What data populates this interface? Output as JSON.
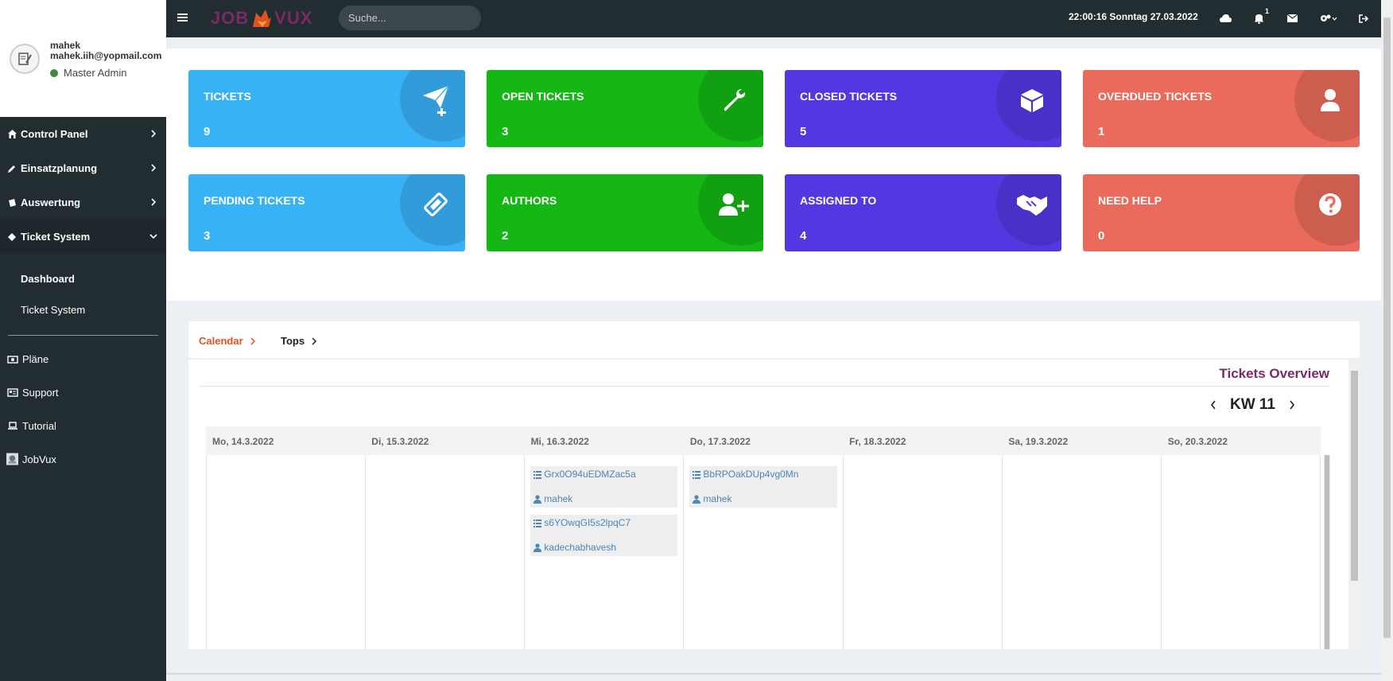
{
  "user": {
    "name": "mahek",
    "email": "mahek.iih@yopmail.com",
    "role": "Master Admin",
    "status_color": "#3d8b3d"
  },
  "sidebar": {
    "items": [
      {
        "label": "Control Panel",
        "icon": "home-icon"
      },
      {
        "label": "Einsatzplanung",
        "icon": "pencil-icon"
      },
      {
        "label": "Auswertung",
        "icon": "database-icon"
      },
      {
        "label": "Ticket System",
        "icon": "ticket-icon"
      }
    ],
    "subitems": [
      {
        "label": "Dashboard"
      },
      {
        "label": "Ticket System"
      }
    ],
    "bottom": [
      {
        "label": "Pläne",
        "icon": "camera-icon"
      },
      {
        "label": "Support",
        "icon": "id-card-icon"
      },
      {
        "label": "Tutorial",
        "icon": "laptop-icon"
      },
      {
        "label": "JobVux",
        "icon": "jobvux-logo-icon"
      }
    ]
  },
  "topbar": {
    "logo_left": "JOB",
    "logo_right": "VUX",
    "search_placeholder": "Suche...",
    "datetime": "22:00:16 Sonntag 27.03.2022",
    "notification_count": "1"
  },
  "cards": [
    {
      "label": "TICKETS",
      "value": "9",
      "icon": "paper-plane-plus-icon",
      "color": "#38b2f7"
    },
    {
      "label": "OPEN TICKETS",
      "value": "3",
      "icon": "wrench-icon",
      "color": "#14b714"
    },
    {
      "label": "CLOSED TICKETS",
      "value": "5",
      "icon": "cube-icon",
      "color": "#5537e2"
    },
    {
      "label": "OVERDUED TICKETS",
      "value": "1",
      "icon": "user-icon",
      "color": "#ea6b5b"
    },
    {
      "label": "PENDING TICKETS",
      "value": "3",
      "icon": "ticket-icon",
      "color": "#38b2f7"
    },
    {
      "label": "AUTHORS",
      "value": "2",
      "icon": "user-plus-icon",
      "color": "#14b714"
    },
    {
      "label": "ASSIGNED TO",
      "value": "4",
      "icon": "handshake-icon",
      "color": "#5537e2"
    },
    {
      "label": "NEED HELP",
      "value": "0",
      "icon": "question-circle-icon",
      "color": "#ea6b5b"
    }
  ],
  "calendar": {
    "tabs": [
      {
        "label": "Calendar",
        "color": "#e0531f"
      },
      {
        "label": "Tops",
        "color": "#222222"
      }
    ],
    "title": "Tickets Overview",
    "week": "KW 11",
    "days": [
      "Mo, 14.3.2022",
      "Di, 15.3.2022",
      "Mi, 16.3.2022",
      "Do, 17.3.2022",
      "Fr, 18.3.2022",
      "Sa, 19.3.2022",
      "So, 20.3.2022"
    ],
    "tickets": [
      {
        "day": 2,
        "id": "Grx0O94uEDMZac5a",
        "user": "mahek"
      },
      {
        "day": 2,
        "id": "s6YOwqGI5s2lpqC7",
        "user": "kadechabhavesh"
      },
      {
        "day": 3,
        "id": "BbRPOakDUp4vg0Mn",
        "user": "mahek"
      }
    ]
  }
}
